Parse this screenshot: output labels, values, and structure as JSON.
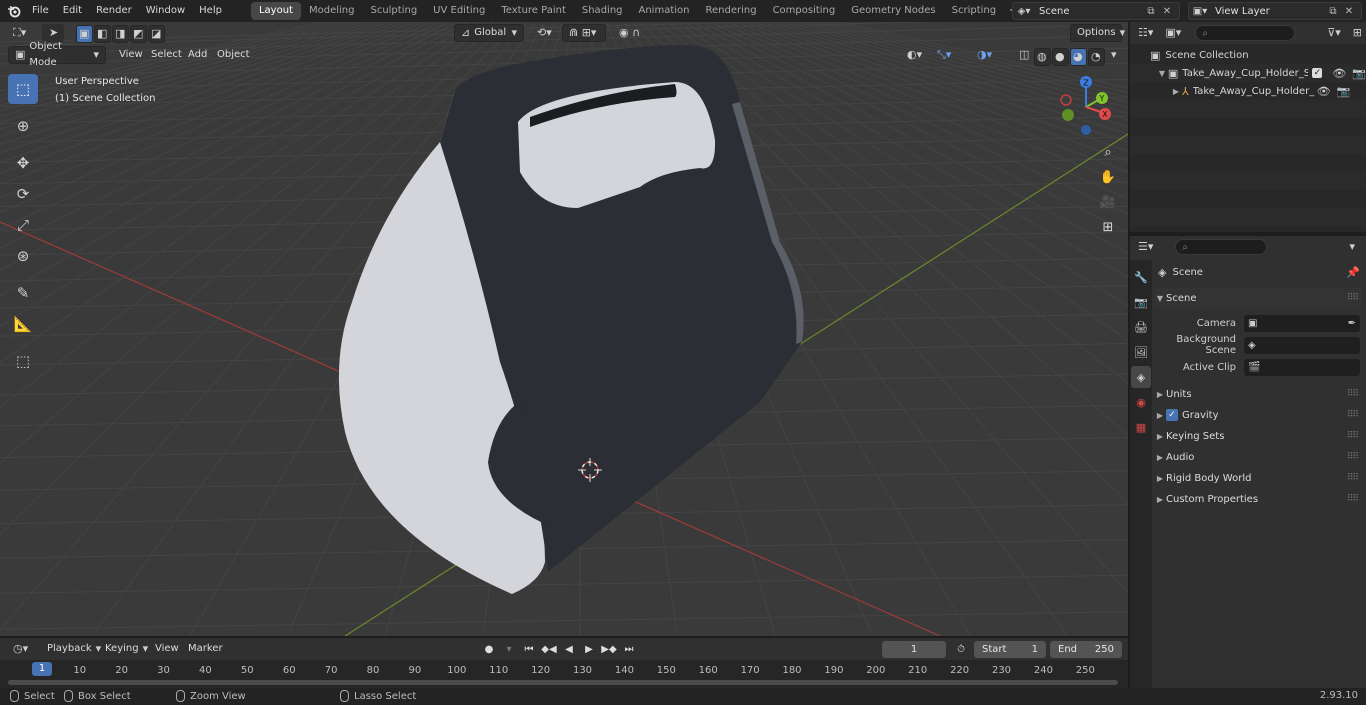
{
  "app": {
    "logo_icon": "blender-logo-icon"
  },
  "menu": [
    "File",
    "Edit",
    "Render",
    "Window",
    "Help"
  ],
  "workspaces": [
    "Layout",
    "Modeling",
    "Sculpting",
    "UV Editing",
    "Texture Paint",
    "Shading",
    "Animation",
    "Rendering",
    "Compositing",
    "Geometry Nodes",
    "Scripting"
  ],
  "active_workspace": "Layout",
  "scene_selector": {
    "value": "Scene"
  },
  "view_layer_selector": {
    "value": "View Layer"
  },
  "viewport": {
    "mode": "Object Mode",
    "menus": [
      "View",
      "Select",
      "Add",
      "Object"
    ],
    "transform_orientation": "Global",
    "options_label": "Options",
    "overlay_line1": "User Perspective",
    "overlay_line2": "(1) Scene Collection",
    "gizmo_axes": {
      "x": "X",
      "y": "Y",
      "z": "Z"
    },
    "colors": {
      "background": "#3a3a3a",
      "x_axis": "#9e3a3a",
      "y_axis": "#6c8a2a",
      "model_dark": "#2b2f35",
      "model_light": "#d4d5da",
      "accent": "#4772b3"
    }
  },
  "tools": [
    "select-box-icon",
    "cursor-icon",
    "move-icon",
    "rotate-icon",
    "scale-icon",
    "transform-icon",
    "annotate-icon",
    "measure-icon",
    "add-cube-icon"
  ],
  "outliner": {
    "root": "Scene Collection",
    "items": [
      "Take_Away_Cup_Holder_Sing",
      "Take_Away_Cup_Holder_"
    ]
  },
  "properties": {
    "header": "Scene",
    "panel": "Scene",
    "fields": [
      {
        "label": "Camera"
      },
      {
        "label": "Background Scene"
      },
      {
        "label": "Active Clip"
      }
    ],
    "subpanels": [
      "Units",
      "Gravity",
      "Keying Sets",
      "Audio",
      "Rigid Body World",
      "Custom Properties"
    ],
    "gravity_checked": true
  },
  "timeline": {
    "menus": [
      "Playback",
      "Keying",
      "View",
      "Marker"
    ],
    "current_frame": "1",
    "start_label": "Start",
    "start_value": "1",
    "end_label": "End",
    "end_value": "250",
    "ticks": [
      "10",
      "20",
      "30",
      "40",
      "50",
      "60",
      "70",
      "80",
      "90",
      "100",
      "110",
      "120",
      "130",
      "140",
      "150",
      "160",
      "170",
      "180",
      "190",
      "200",
      "210",
      "220",
      "230",
      "240",
      "250"
    ],
    "playhead": "1"
  },
  "statusbar": {
    "items": [
      "Select",
      "Box Select",
      "Zoom View",
      "Lasso Select"
    ],
    "version": "2.93.10"
  }
}
